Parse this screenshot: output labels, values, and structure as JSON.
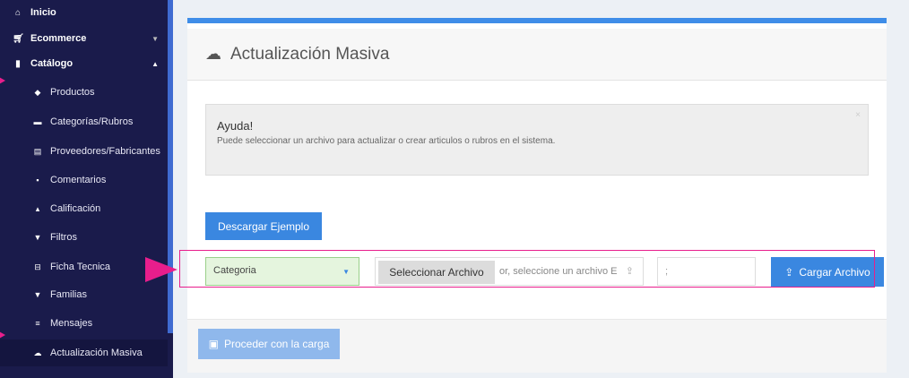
{
  "sidebar": {
    "top_items": [
      {
        "label": "Inicio",
        "icon": "home-icon"
      },
      {
        "label": "Ecommerce",
        "icon": "cart-icon"
      },
      {
        "label": "Catálogo",
        "icon": "book-icon"
      }
    ],
    "sub_items": [
      {
        "label": "Productos",
        "icon": "tag-icon"
      },
      {
        "label": "Categorías/Rubros",
        "icon": "folder-icon"
      },
      {
        "label": "Proveedores/Fabricantes",
        "icon": "list-icon"
      },
      {
        "label": "Comentarios",
        "icon": "comment-icon"
      },
      {
        "label": "Calificación",
        "icon": "thumbs-up-icon"
      },
      {
        "label": "Filtros",
        "icon": "filter-icon"
      },
      {
        "label": "Ficha Tecnica",
        "icon": "spec-icon"
      },
      {
        "label": "Familias",
        "icon": "filter-icon"
      },
      {
        "label": "Mensajes",
        "icon": "menu-icon"
      },
      {
        "label": "Actualización Masiva",
        "icon": "cloud-upload-icon"
      }
    ]
  },
  "header": {
    "title": "Actualización Masiva"
  },
  "help": {
    "title": "Ayuda!",
    "text": "Puede seleccionar un archivo para actualizar o crear articulos o rubros en el sistema."
  },
  "buttons": {
    "download": "Descargar Ejemplo",
    "select_file": "Seleccionar Archivo",
    "upload": "Cargar Archivo",
    "proceed": "Proceder con la carga"
  },
  "form": {
    "type_selected": "Categoria",
    "file_placeholder": "or, seleccione un archivo E",
    "separator": ";"
  },
  "colors": {
    "sidebar": "#1a1b4b",
    "accent": "#3a87e0",
    "highlight": "#e81e8c"
  }
}
